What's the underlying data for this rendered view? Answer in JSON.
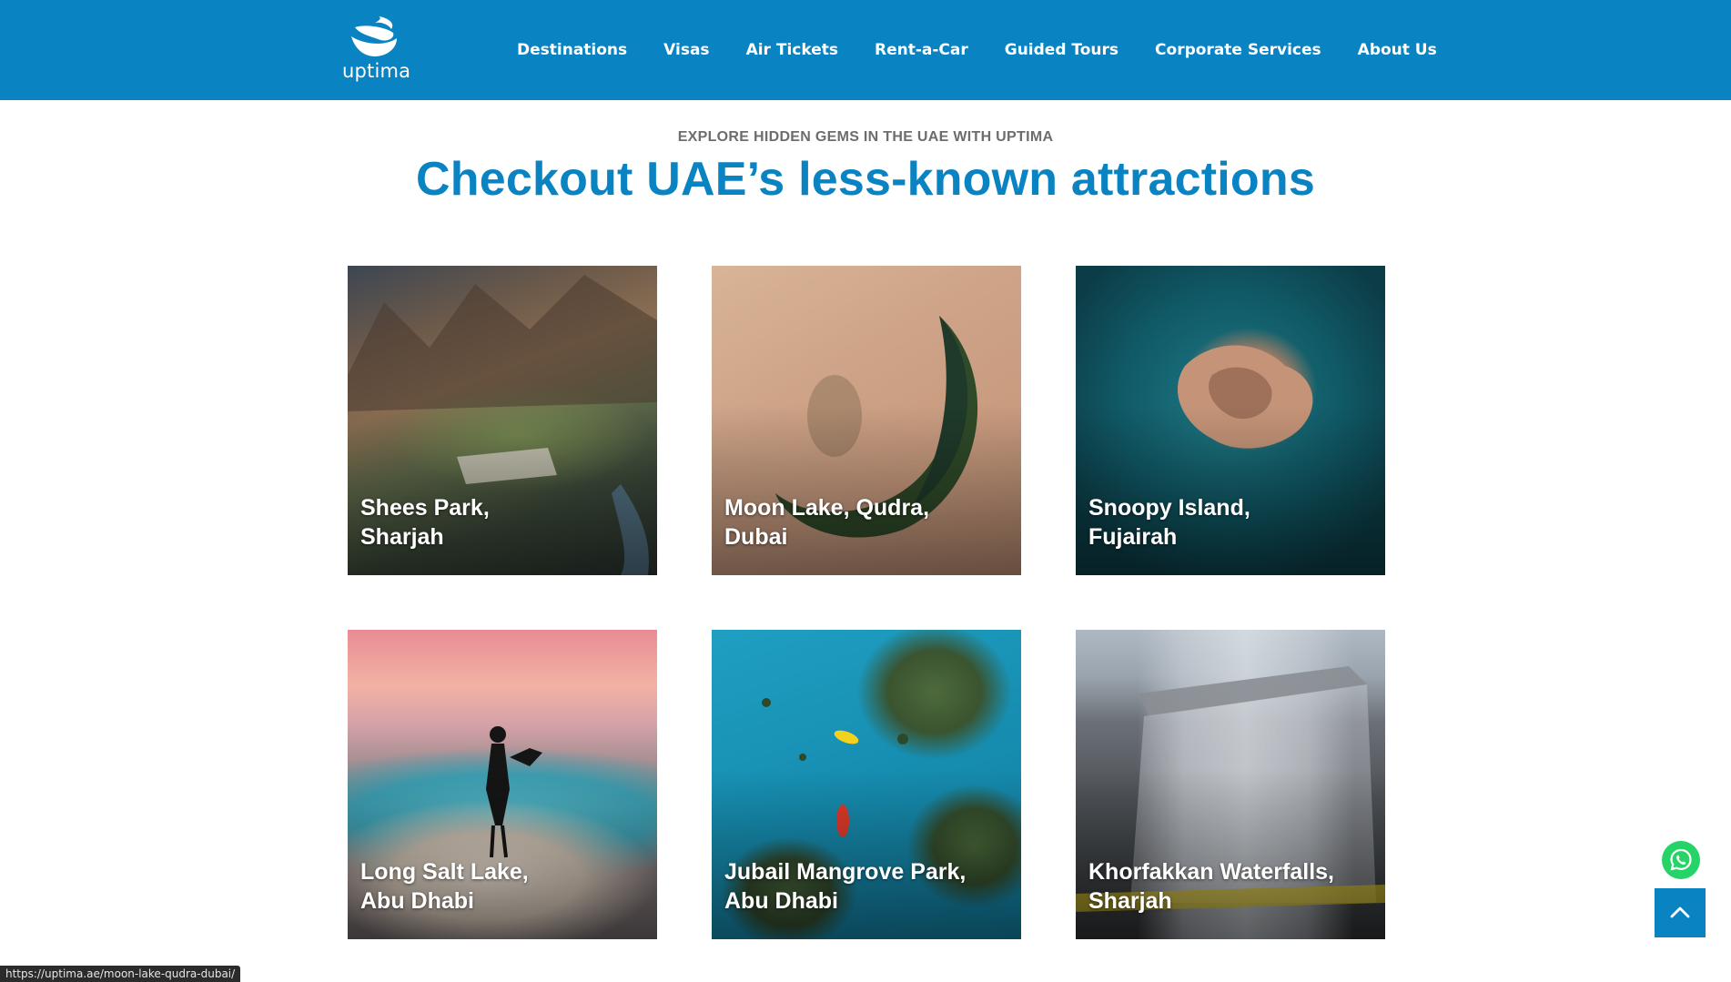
{
  "header": {
    "logo_text": "uptima",
    "nav": [
      "Destinations",
      "Visas",
      "Air Tickets",
      "Rent-a-Car",
      "Guided Tours",
      "Corporate Services",
      "About Us"
    ]
  },
  "intro": {
    "eyebrow": "EXPLORE HIDDEN GEMS IN THE UAE WITH UPTIMA",
    "title": "Checkout UAE’s less-known attractions"
  },
  "cards": [
    {
      "line1": "Shees Park,",
      "line2": "Sharjah"
    },
    {
      "line1": "Moon Lake, Qudra,",
      "line2": "Dubai"
    },
    {
      "line1": "Snoopy Island,",
      "line2": "Fujairah"
    },
    {
      "line1": "Long Salt Lake,",
      "line2": "Abu Dhabi"
    },
    {
      "line1": "Jubail Mangrove Park,",
      "line2": "Abu Dhabi"
    },
    {
      "line1": "Khorfakkan Waterfalls,",
      "line2": "Sharjah"
    }
  ],
  "floating": {
    "whatsapp_icon": "whatsapp-icon",
    "back_to_top_icon": "chevron-up-icon"
  },
  "status_bar": {
    "url": "https://uptima.ae/moon-lake-qudra-dubai/"
  },
  "colors": {
    "brand_blue": "#0a83c2",
    "eyebrow_gray": "#6d6d6d",
    "whatsapp_green": "#25d366"
  }
}
